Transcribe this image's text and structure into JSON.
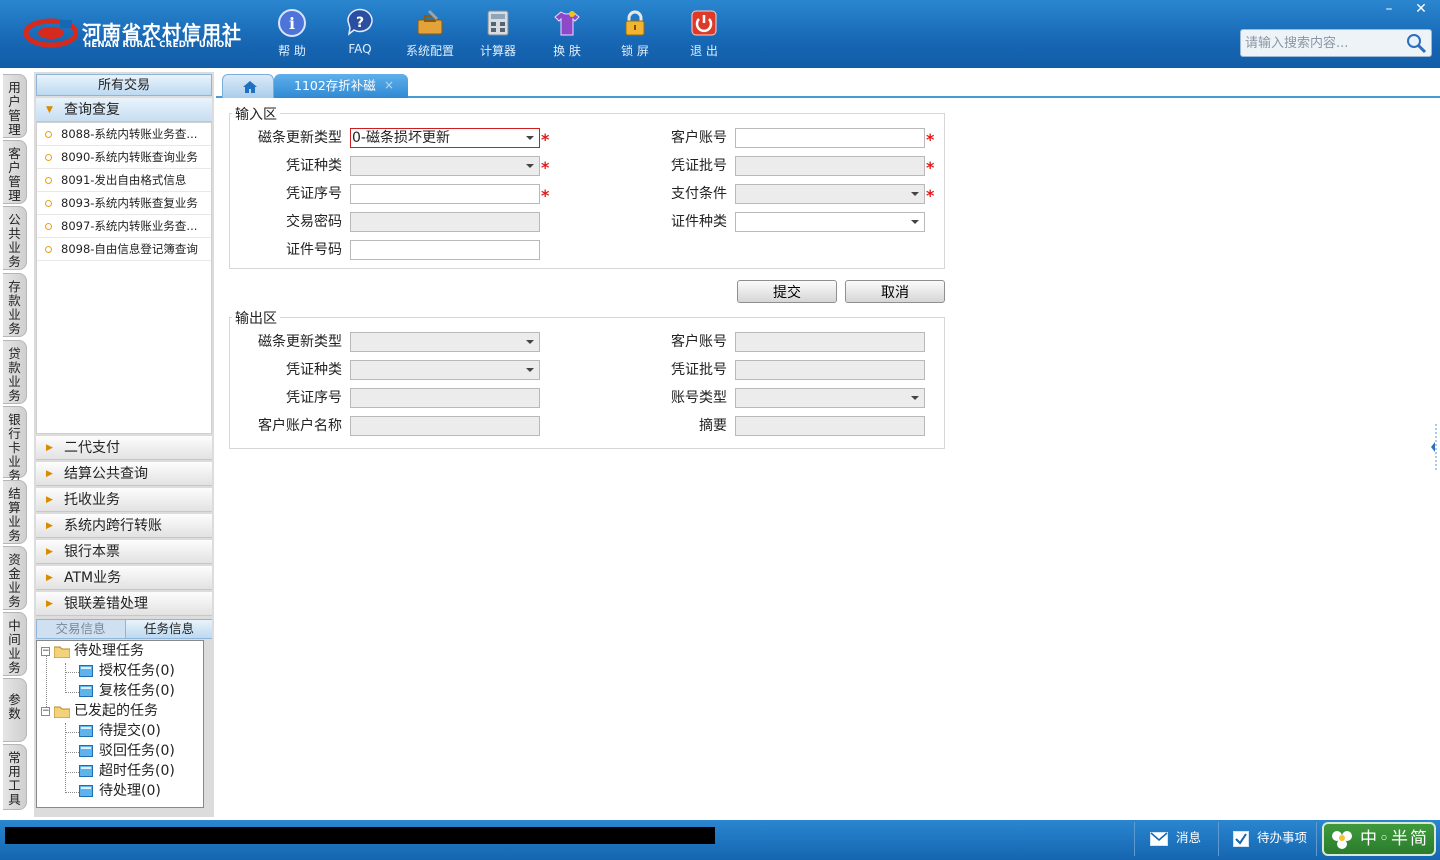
{
  "header": {
    "logo_cn": "河南省农村信用社",
    "logo_en": "HENAN RURAL CREDIT UNION",
    "toolbar": [
      {
        "label": "帮 助",
        "icon": "help-icon"
      },
      {
        "label": "FAQ",
        "icon": "faq-icon"
      },
      {
        "label": "系统配置",
        "icon": "config-toolbox-icon"
      },
      {
        "label": "计算器",
        "icon": "calculator-icon"
      },
      {
        "label": "换 肤",
        "icon": "skin-shirt-icon"
      },
      {
        "label": "锁 屏",
        "icon": "lock-icon"
      },
      {
        "label": "退 出",
        "icon": "power-icon"
      }
    ],
    "window_controls": {
      "minimize": "–",
      "close": "✕"
    },
    "search": {
      "placeholder": "请输入搜索内容..."
    }
  },
  "vertical_tabs": [
    "用户管理",
    "客户管理",
    "公共业务",
    "存款业务",
    "贷款业务",
    "银行卡业务",
    "结算业务",
    "资金业务",
    "中间业务",
    "参数",
    "常用工具"
  ],
  "sidebar": {
    "title": "所有交易",
    "expanded_group": "查询查复",
    "items": [
      "8088-系统内转账业务查...",
      "8090-系统内转账查询业务",
      "8091-发出自由格式信息",
      "8093-系统内转账查复业务",
      "8097-系统内转账业务查...",
      "8098-自由信息登记簿查询"
    ],
    "groups": [
      "二代支付",
      "结算公共查询",
      "托收业务",
      "系统内跨行转账",
      "银行本票",
      "ATM业务",
      "银联差错处理"
    ],
    "task_tabs": {
      "inactive": "交易信息",
      "active": "任务信息"
    },
    "tree": {
      "pending": "待处理任务",
      "authorize": "授权任务(0)",
      "review": "复核任务(0)",
      "initiated": "已发起的任务",
      "to_submit": "待提交(0)",
      "rejected": "驳回任务(0)",
      "timeout": "超时任务(0)",
      "to_process": "待处理(0)"
    }
  },
  "tabs": {
    "active": "1102存折补磁",
    "close": "×"
  },
  "input_section": {
    "legend": "输入区",
    "magstripe_type_label": "磁条更新类型",
    "magstripe_type_value": "0-磁条损坏更新",
    "customer_account_label": "客户账号",
    "voucher_type_label": "凭证种类",
    "voucher_batch_label": "凭证批号",
    "voucher_serial_label": "凭证序号",
    "payment_condition_label": "支付条件",
    "transaction_password_label": "交易密码",
    "id_type_label": "证件种类",
    "id_number_label": "证件号码",
    "required_mark": "*"
  },
  "buttons": {
    "submit": "提交",
    "cancel": "取消"
  },
  "output_section": {
    "legend": "输出区",
    "magstripe_type_label": "磁条更新类型",
    "customer_account_label": "客户账号",
    "voucher_type_label": "凭证种类",
    "voucher_batch_label": "凭证批号",
    "voucher_serial_label": "凭证序号",
    "account_type_label": "账号类型",
    "account_name_label": "客户账户名称",
    "summary_label": "摘要"
  },
  "statusbar": {
    "messages": "消息",
    "todo": "待办事项",
    "ime": "中◦半简"
  },
  "colors": {
    "header_blue": "#1767b4",
    "active_tab": "#2f89d3",
    "required_red": "#e01b1b"
  }
}
